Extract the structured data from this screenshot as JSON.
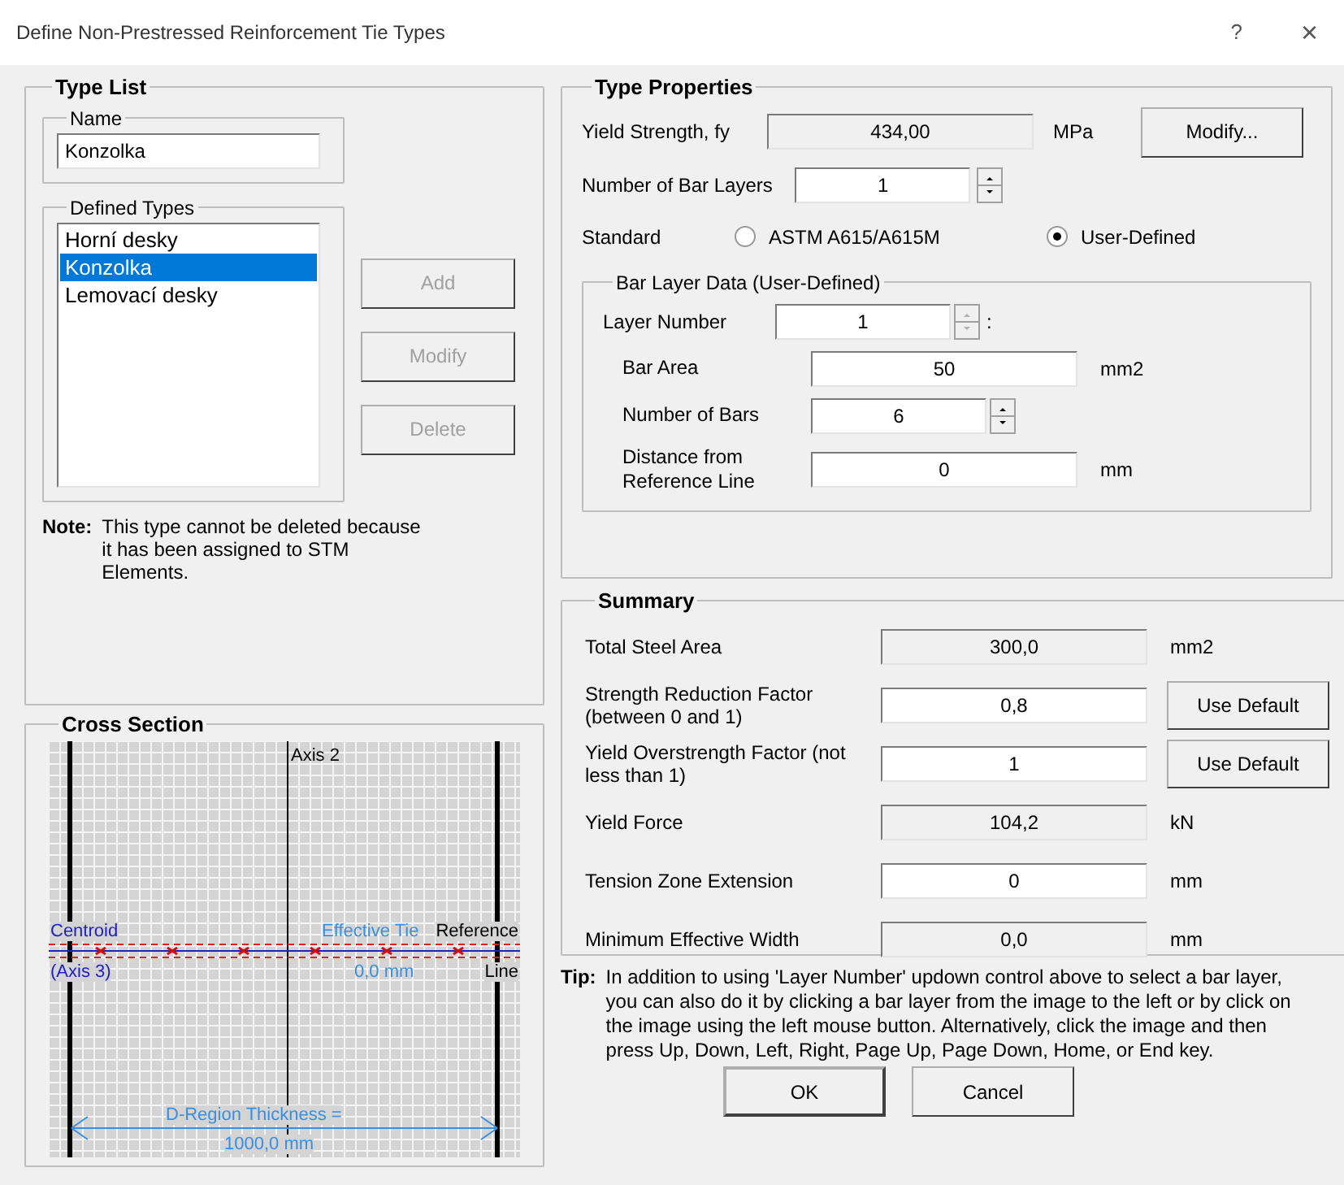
{
  "window": {
    "title": "Define Non-Prestressed Reinforcement Tie Types",
    "help": "?",
    "close": "×"
  },
  "type_list": {
    "title": "Type List",
    "name": {
      "label": "Name",
      "value": "Konzolka"
    },
    "defined_types": {
      "label": "Defined Types",
      "items": [
        {
          "label": "Horní desky",
          "selected": false
        },
        {
          "label": "Konzolka",
          "selected": true
        },
        {
          "label": "Lemovací desky",
          "selected": false
        }
      ]
    },
    "buttons": [
      {
        "label": "Add",
        "disabled": true
      },
      {
        "label": "Modify",
        "disabled": true
      },
      {
        "label": "Delete",
        "disabled": true
      }
    ],
    "note": {
      "label": "Note:",
      "text": "This type cannot be deleted because it has been assigned to STM Elements."
    }
  },
  "cross_section": {
    "title": "Cross Section",
    "axis_2": "Axis 2",
    "centroid": "Centroid",
    "axis_3": "(Axis 3)",
    "effective_tie": "Effective Tie",
    "offset": "0,0 mm",
    "reference": "Reference",
    "line": "Line",
    "thickness": "D-Region Thickness =",
    "thickness_value": "1000,0 mm"
  },
  "type_properties": {
    "title": "Type Properties",
    "yield_strength": {
      "label": "Yield Strength, fy",
      "value": "434,00",
      "unit": "MPa",
      "button": "Modify..."
    },
    "bar_layers": {
      "label": "Number of Bar Layers",
      "value": "1"
    },
    "standard": {
      "label": "Standard",
      "options": [
        {
          "label": "ASTM A615/A615M",
          "selected": false
        },
        {
          "label": "User-Defined",
          "selected": true
        }
      ]
    },
    "bar_layer_data": {
      "title": "Bar Layer Data (User-Defined)",
      "layer_number": {
        "label": "Layer Number",
        "value": "1",
        "suffix": ":",
        "disabled": true
      },
      "rows": [
        {
          "label": "Bar Area",
          "value": "50",
          "unit": "mm2",
          "kind": "field"
        },
        {
          "label": "Number of Bars",
          "value": "6",
          "kind": "spinner"
        },
        {
          "label": "Distance from Reference Line",
          "value": "0",
          "unit": "mm",
          "kind": "field"
        }
      ]
    }
  },
  "summary": {
    "title": "Summary",
    "rows": [
      {
        "label": "Total Steel Area",
        "value": "300,0",
        "unit": "mm2",
        "read_only": true
      },
      {
        "label": "Strength Reduction Factor (between 0 and 1)",
        "value": "0,8",
        "button": "Use Default",
        "read_only": false
      },
      {
        "label": "Yield Overstrength Factor (not less than 1)",
        "value": "1",
        "button": "Use Default",
        "read_only": false
      },
      {
        "label": "Yield Force",
        "value": "104,2",
        "unit": "kN",
        "read_only": true
      },
      {
        "label": "Tension Zone Extension",
        "value": "0",
        "unit": "mm",
        "read_only": false
      },
      {
        "label": "Minimum Effective Width",
        "value": "0,0",
        "unit": "mm",
        "read_only": true
      }
    ]
  },
  "tip": {
    "label": "Tip:",
    "text": "In addition to using 'Layer Number' updown control above to select a bar layer, you can also do it by clicking a bar layer from the image to the left or by click on the image using the left mouse button. Alternatively, click the image and then press Up, Down, Left, Right, Page Up, Page Down, Home, or End key."
  },
  "buttons": [
    {
      "label": "OK",
      "default": true
    },
    {
      "label": "Cancel",
      "default": false
    }
  ]
}
